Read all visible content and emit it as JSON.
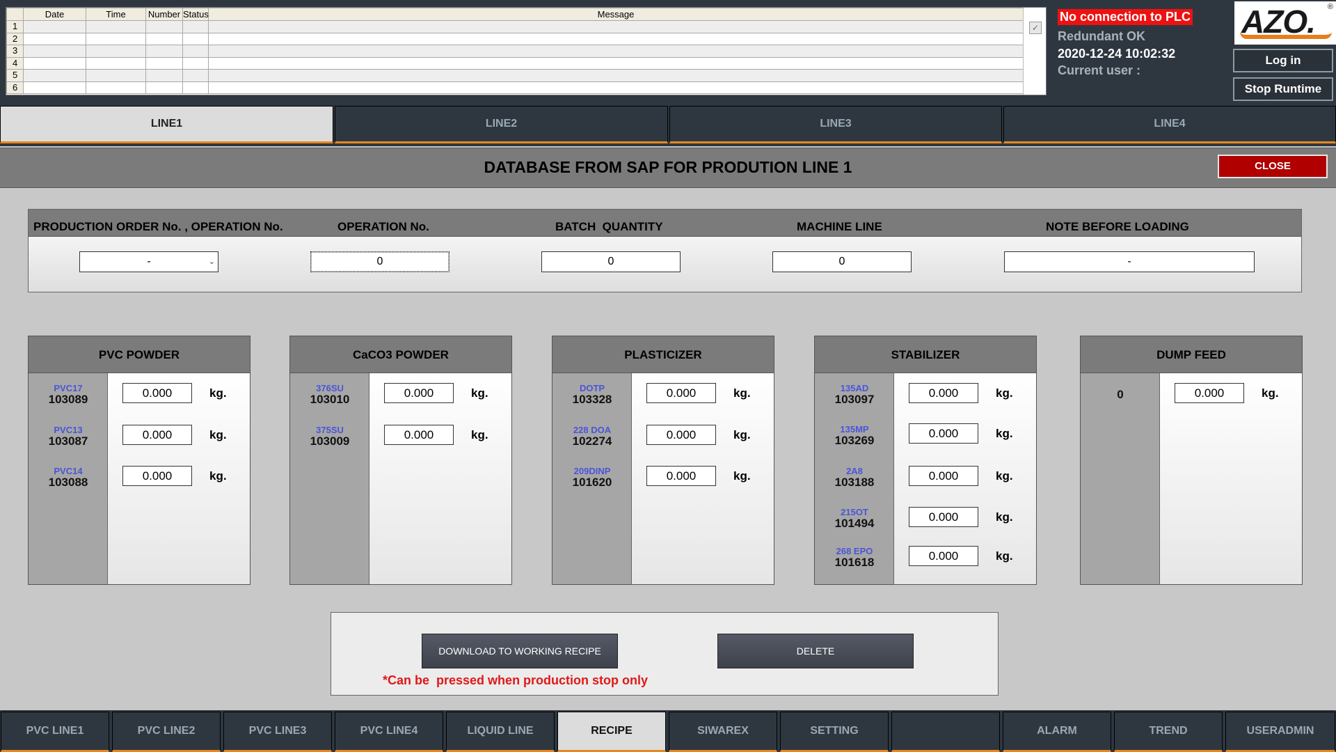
{
  "alarm_table": {
    "headers": [
      "Date",
      "Time",
      "Number",
      "Status",
      "Message"
    ],
    "rows": [
      "1",
      "2",
      "3",
      "4",
      "5",
      "6"
    ]
  },
  "status": {
    "plc": "No connection to PLC",
    "redundant": "Redundant OK",
    "datetime": "2020-12-24 10:02:32",
    "current_user": "Current user :"
  },
  "logo": {
    "text": "AZO.",
    "reg": "®"
  },
  "buttons": {
    "login": "Log in",
    "stop_runtime": "Stop Runtime",
    "close": "CLOSE"
  },
  "line_tabs": [
    "LINE1",
    "LINE2",
    "LINE3",
    "LINE4"
  ],
  "active_line_tab": "LINE1",
  "page_title": "DATABASE FROM SAP FOR PRODUTION LINE 1",
  "order": {
    "labels": {
      "production_order": "PRODUCTION ORDER No. , OPERATION No.",
      "operation": "OPERATION No.",
      "batch": "BATCH  QUANTITY",
      "machine": "MACHINE LINE",
      "note": "NOTE BEFORE LOADING"
    },
    "values": {
      "production_order": "-",
      "operation": "0",
      "batch": "0",
      "machine": "0",
      "note": "-"
    }
  },
  "materials": {
    "pvc_powder": {
      "title": "PVC POWDER",
      "items": [
        {
          "code": "PVC17",
          "number": "103089",
          "value": "0.000",
          "unit": "kg."
        },
        {
          "code": "PVC13",
          "number": "103087",
          "value": "0.000",
          "unit": "kg."
        },
        {
          "code": "PVC14",
          "number": "103088",
          "value": "0.000",
          "unit": "kg."
        }
      ]
    },
    "caco3_powder": {
      "title": "CaCO3 POWDER",
      "items": [
        {
          "code": "376SU",
          "number": "103010",
          "value": "0.000",
          "unit": "kg."
        },
        {
          "code": "375SU",
          "number": "103009",
          "value": "0.000",
          "unit": "kg."
        }
      ]
    },
    "plasticizer": {
      "title": "PLASTICIZER",
      "items": [
        {
          "code": "DOTP",
          "number": "103328",
          "value": "0.000",
          "unit": "kg."
        },
        {
          "code": "228 DOA",
          "number": "102274",
          "value": "0.000",
          "unit": "kg."
        },
        {
          "code": "209DINP",
          "number": "101620",
          "value": "0.000",
          "unit": "kg."
        }
      ]
    },
    "stabilizer": {
      "title": "STABILIZER",
      "items": [
        {
          "code": "135AD",
          "number": "103097",
          "value": "0.000",
          "unit": "kg."
        },
        {
          "code": "135MP",
          "number": "103269",
          "value": "0.000",
          "unit": "kg."
        },
        {
          "code": "2A8",
          "number": "103188",
          "value": "0.000",
          "unit": "kg."
        },
        {
          "code": "215OT",
          "number": "101494",
          "value": "0.000",
          "unit": "kg."
        },
        {
          "code": "268 EPO",
          "number": "101618",
          "value": "0.000",
          "unit": "kg."
        }
      ]
    },
    "dump_feed": {
      "title": "DUMP FEED",
      "items": [
        {
          "number": "0",
          "value": "0.000",
          "unit": "kg."
        }
      ]
    }
  },
  "actions": {
    "download": "DOWNLOAD TO WORKING RECIPE",
    "delete": "DELETE",
    "note": "*Can be  pressed when production stop only"
  },
  "bottom_nav": [
    "PVC LINE1",
    "PVC LINE2",
    "PVC LINE3",
    "PVC LINE4",
    "LIQUID LINE",
    "RECIPE",
    "SIWAREX",
    "SETTING",
    "",
    "ALARM",
    "TREND",
    "USERADMIN"
  ],
  "active_bottom_nav": "RECIPE",
  "colors": {
    "background": "#c8c8c8",
    "dark_panel": "#2e3740",
    "header_grey": "#7b7b7b",
    "accent_orange": "#e8881e",
    "alarm_red": "#ee1111",
    "close_red": "#b00000",
    "material_code_blue": "#4a55d8"
  },
  "icons": {
    "alarm_acknowledge": "acknowledge-icon",
    "dropdown": "chevron-down-icon"
  }
}
